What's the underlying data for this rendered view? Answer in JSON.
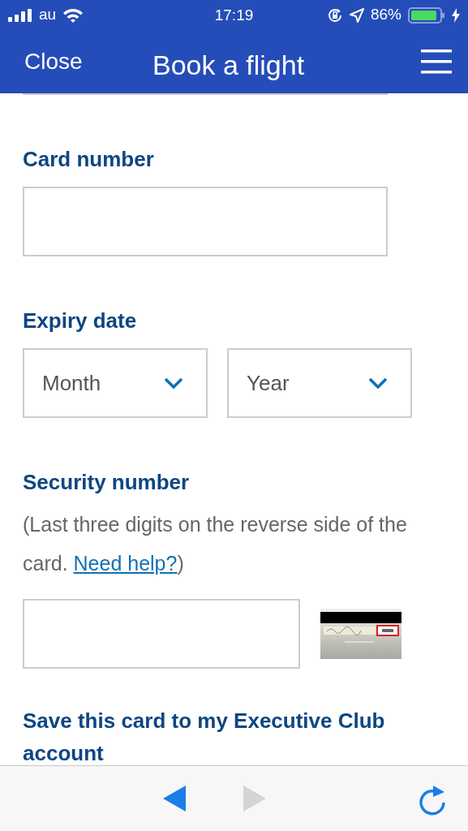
{
  "status_bar": {
    "carrier": "au",
    "time": "17:19",
    "battery": "86%"
  },
  "header": {
    "close": "Close",
    "title": "Book a flight"
  },
  "form": [
    {
      "kind": "text",
      "label": "Card number"
    },
    {
      "kind": "selects",
      "label": "Expiry date",
      "selects": [
        {
          "value": "Month"
        },
        {
          "value": "Year"
        }
      ]
    },
    {
      "kind": "security",
      "label": "Security number",
      "hint": "(Last three digits on the reverse side of the card.",
      "help_link": "Need help?",
      "hint_end": ")"
    },
    {
      "kind": "heading",
      "label": "Save this card to my Executive Club account"
    }
  ],
  "toolbar": {
    "back": {
      "disabled": false
    },
    "forward": {
      "disabled": true
    }
  }
}
